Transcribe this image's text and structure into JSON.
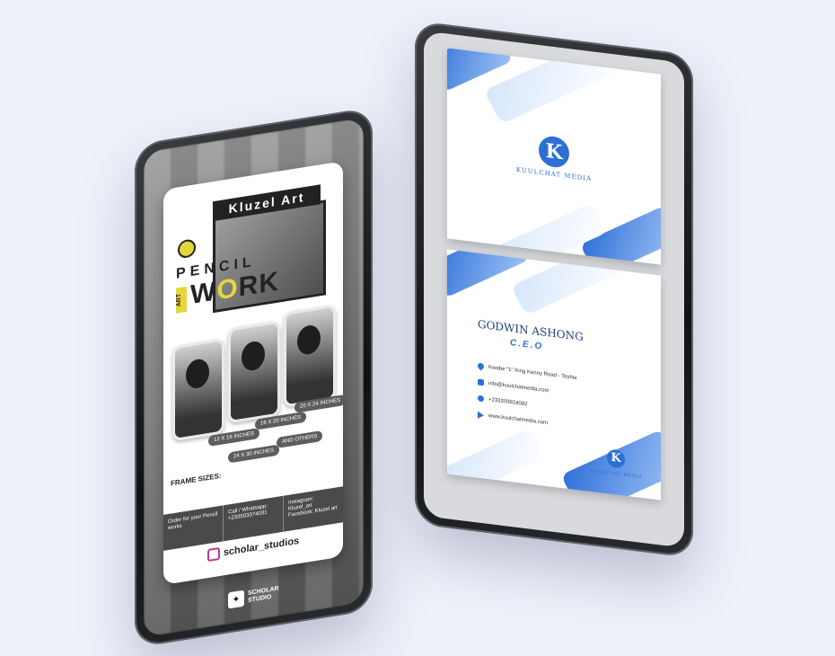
{
  "left_flyer": {
    "brand": "Kluzel Art",
    "headline_pencil": "PENCIL",
    "headline_art": "ART",
    "headline_work_prefix": "W",
    "headline_work_highlight": "O",
    "headline_work_suffix": "RK",
    "frame_sizes_label": "FRAME SIZES:",
    "sizes": [
      "12 X 16 INCHES",
      "16 X 20 INCHES",
      "20 X 24 INCHES",
      "24 X 30 INCHES",
      "AND OTHERS"
    ],
    "contacts": [
      "Order for your Pencil works",
      "Call / Whatsapp: +233503374031",
      "Instagram: Kluzel_art Facebook: Kluzel art"
    ],
    "social_handle": "scholar_studios",
    "studio_name_1": "SCHOLAR",
    "studio_name_2": "STUDIO"
  },
  "right_card": {
    "logo_letter": "K",
    "company": "KUULCHAT MEDIA",
    "person_name": "GODWIN ASHONG",
    "person_role": "C.E.O",
    "info": [
      {
        "icon": "location-pin-icon",
        "text": "Kwabe \"1\" King Kenny Road - Teshie"
      },
      {
        "icon": "email-icon",
        "text": "info@kuulchatmedia.com"
      },
      {
        "icon": "phone-icon",
        "text": "+233209924082"
      },
      {
        "icon": "web-arrow-icon",
        "text": "www.kuulchatmedia.com"
      }
    ],
    "accent_color": "#2c6fd6"
  }
}
